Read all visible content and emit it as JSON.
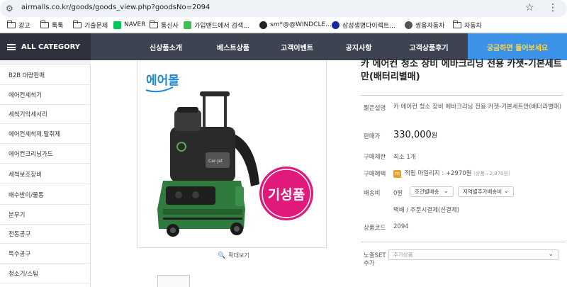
{
  "browser": {
    "url": "airmalls.co.kr/goods/goods_view.php?goodsNo=2094"
  },
  "bookmarks": [
    {
      "label": "광고",
      "icon": "folder-icon"
    },
    {
      "label": "톡톡",
      "icon": "folder-icon"
    },
    {
      "label": "기출문제",
      "icon": "folder-icon"
    },
    {
      "label": "NAVER",
      "icon": "naver-icon",
      "color": "#03c75a"
    },
    {
      "label": "통신사",
      "icon": "folder-icon"
    },
    {
      "label": "가입밴드에서 검색...",
      "icon": "band-icon",
      "color": "#3ac24e"
    },
    {
      "label": "sm*@@WINDCLE...",
      "icon": "site-icon",
      "color": "#222222"
    },
    {
      "label": "삼성생명다이렉트...",
      "icon": "samsung-icon",
      "color": "#1428a0"
    },
    {
      "label": "쌍용자동차",
      "icon": "ssangyong-icon",
      "color": "#555555"
    },
    {
      "label": "자동차",
      "icon": "folder-icon"
    }
  ],
  "nav": {
    "all_category": "ALL CATEGORY",
    "menus": [
      "신상품소개",
      "베스트상품",
      "고객이벤트",
      "공지사항",
      "고객상품후기",
      "궁금하면 들어보세요"
    ]
  },
  "sidebar": {
    "items": [
      "B2B 대량판매",
      "에어컨세척기",
      "세척기악세서리",
      "에어컨세척제.탈취제",
      "에어컨크리닝가드",
      "세척보조장비",
      "배수받이/물통",
      "분무기",
      "전동공구",
      "특수공구",
      "청소기/스팀"
    ]
  },
  "gallery": {
    "brand": "에어몰",
    "badge": "기성품",
    "model_label": "Car-Jet",
    "zoom_label": "확대보기"
  },
  "product": {
    "title": "카 에어컨 청소 장비 에바크리닝 전용 카젯-기본세트만(배터리별매)",
    "short_desc_label": "짧은설명",
    "short_desc": "카 에어컨 청소 장비 에바크리닝 전용 카젯-기본세트만(배터리별매)",
    "price_label": "판매가",
    "price": "330,000",
    "price_unit": "원",
    "purchase_limit_label": "구매제한",
    "purchase_limit": "최소 1개",
    "benefit_label": "구매혜택",
    "benefit_text": "적립 마일리지 : +2970원",
    "benefit_note": "(상품 : 2,970원)",
    "shipping_label": "배송비",
    "shipping_fee": "0원",
    "shipping_option1": "조건별배송",
    "shipping_option2": "지역별추가배송비",
    "shipping_method": "택배 / 주문시결제(선결제)",
    "code_label": "상품코드",
    "code": "2094",
    "set_label": "노출SET 추가",
    "set_placeholder": "추가상품"
  }
}
